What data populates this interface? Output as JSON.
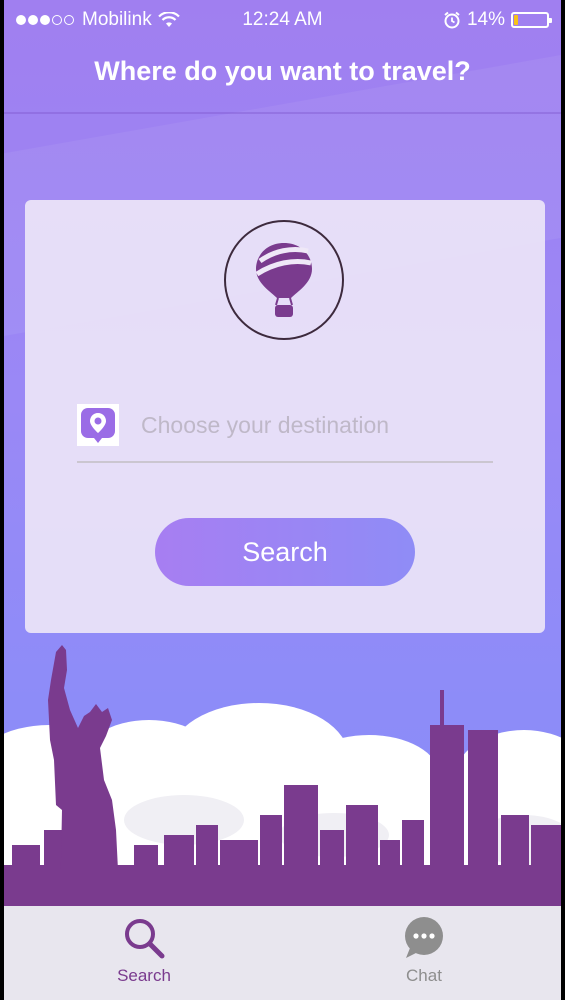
{
  "status_bar": {
    "carrier": "Mobilink",
    "time": "12:24 AM",
    "battery_percent": "14%",
    "signal_bars": 3,
    "battery_level": 0.14
  },
  "header": {
    "title": "Where do you want to travel?"
  },
  "search_card": {
    "logo_icon": "hot-air-balloon-icon",
    "destination_icon": "location-pin-icon",
    "destination_placeholder": "Choose your destination",
    "destination_value": "",
    "search_button_label": "Search"
  },
  "tab_bar": {
    "tabs": [
      {
        "label": "Search",
        "icon": "search-icon",
        "active": true
      },
      {
        "label": "Chat",
        "icon": "chat-bubble-icon",
        "active": false
      }
    ]
  },
  "colors": {
    "accent_purple": "#7a3b8e",
    "gradient_start": "#a07ff0",
    "gradient_end": "#8a8ff7",
    "battery_fill": "#f7c21a"
  }
}
